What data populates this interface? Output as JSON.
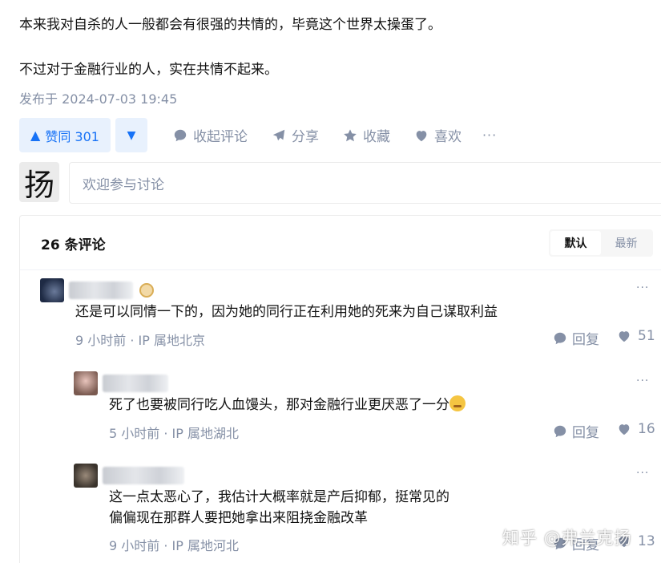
{
  "post": {
    "paragraphs": [
      "本来我对自杀的人一般都会有很强的共情的，毕竟这个世界太操蛋了。",
      "不过对于金融行业的人，实在共情不起来。"
    ],
    "published": "发布于 2024-07-03 19:45"
  },
  "actions": {
    "vote_up": "赞同 301",
    "collapse_comments": "收起评论",
    "share": "分享",
    "favorite": "收藏",
    "like": "喜欢",
    "more": "···"
  },
  "composer": {
    "avatar_char": "扬",
    "placeholder": "欢迎参与讨论"
  },
  "comments": {
    "title": "26 条评论",
    "sort": {
      "default": "默认",
      "latest": "最新"
    },
    "items": [
      {
        "text": "还是可以同情一下的，因为她的同行正在利用她的死来为自己谋取利益",
        "meta": "9 小时前 · IP 属地北京",
        "reply": "回复",
        "likes": "51"
      },
      {
        "text": "死了也要被同行吃人血馒头，那对金融行业更厌恶了一分",
        "meta": "5 小时前 · IP 属地湖北",
        "reply": "回复",
        "likes": "16"
      },
      {
        "text_lines": [
          "这一点太恶心了，我估计大概率就是产后抑郁，挺常见的",
          "偏偏现在那群人要把她拿出来阻挠金融改革"
        ],
        "meta": "9 小时前 · IP 属地河北",
        "reply": "回复",
        "likes": "13"
      }
    ]
  },
  "watermark": "知乎 @弗兰克扬",
  "colors": {
    "accent": "#1772f6",
    "accent_bg": "#e8f1fd",
    "muted": "#8590a6"
  }
}
